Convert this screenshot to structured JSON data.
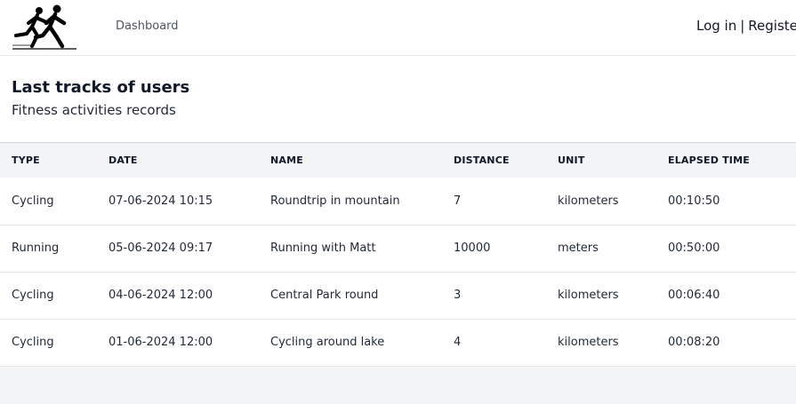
{
  "navbar": {
    "logo": "runners-logo",
    "dashboard_label": "Dashboard",
    "login_label": "Log in",
    "separator": "|",
    "register_label": "Register"
  },
  "header": {
    "title": "Last tracks of users",
    "subtitle": "Fitness activities records"
  },
  "table": {
    "columns": [
      "TYPE",
      "DATE",
      "NAME",
      "DISTANCE",
      "UNIT",
      "ELAPSED TIME"
    ],
    "rows": [
      [
        "Cycling",
        "07-06-2024 10:15",
        "Roundtrip in mountain",
        "7",
        "kilometers",
        "00:10:50"
      ],
      [
        "Running",
        "05-06-2024 09:17",
        "Running with Matt",
        "10000",
        "meters",
        "00:50:00"
      ],
      [
        "Cycling",
        "04-06-2024 12:00",
        "Central Park round",
        "3",
        "kilometers",
        "00:06:40"
      ],
      [
        "Cycling",
        "01-06-2024 12:00",
        "Cycling around lake",
        "4",
        "kilometers",
        "00:08:20"
      ]
    ]
  }
}
